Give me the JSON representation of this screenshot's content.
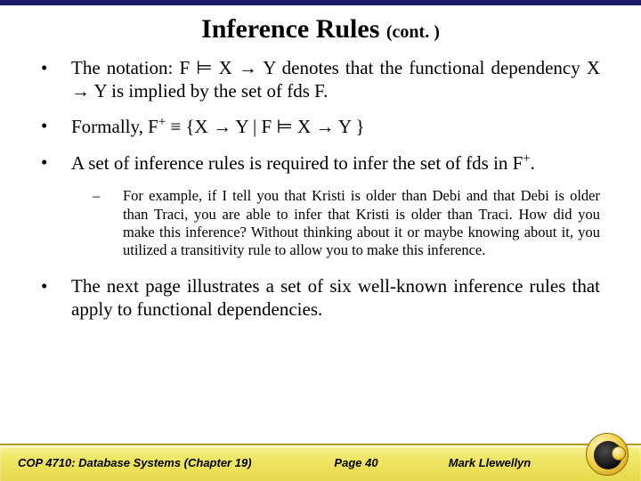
{
  "title_main": "Inference Rules ",
  "title_cont": "(cont. )",
  "bullets": {
    "b1": "The notation: F ⊨ X → Y denotes that the functional dependency X → Y is implied by the set of fds F.",
    "b2_pre": "Formally, F",
    "b2_sup": "+",
    "b2_post": " ≡ {X → Y | F ⊨ X → Y }",
    "b3_pre": "A set of inference rules is required to infer the set of fds in F",
    "b3_sup": "+",
    "b3_post": ".",
    "sub1": "For example, if I tell you that Kristi is older than Debi and that Debi is older than Traci, you are able to infer that Kristi is older than Traci.  How did you make this inference?  Without thinking about it or maybe knowing about it, you utilized a transitivity rule to allow you to make this inference.",
    "b4": "The next page illustrates a set of six well-known inference rules that apply to functional dependencies."
  },
  "footer": {
    "course": "COP 4710: Database Systems  (Chapter 19)",
    "page": "Page 40",
    "author": "Mark Llewellyn"
  },
  "icons": {
    "bullet": "•",
    "dash": "–"
  }
}
